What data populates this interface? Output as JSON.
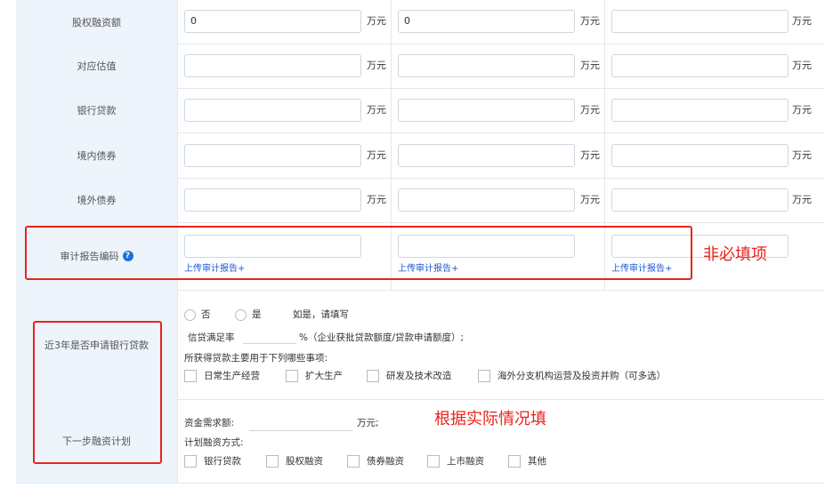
{
  "units": "万元",
  "rows": {
    "equity_financing": {
      "label": "股权融资额",
      "values": [
        "0",
        "0",
        ""
      ]
    },
    "valuation": {
      "label": "对应估值",
      "values": [
        "",
        "",
        ""
      ]
    },
    "bank_loan": {
      "label": "银行贷款",
      "values": [
        "",
        "",
        ""
      ]
    },
    "domestic_bond": {
      "label": "境内债券",
      "values": [
        "",
        "",
        ""
      ]
    },
    "foreign_bond": {
      "label": "境外债券",
      "values": [
        "",
        "",
        ""
      ]
    }
  },
  "audit": {
    "label": "审计报告编码",
    "help_icon": "?",
    "upload_label": "上传审计报告+"
  },
  "bank_apply": {
    "label": "近3年是否申请银行贷款",
    "no": "否",
    "yes": "是",
    "if_yes": "如是，请填写",
    "rate_label": "信贷满足率",
    "rate_note": "%（企业获批贷款额度/贷款申请额度）;",
    "usage_label": "所获得贷款主要用于下列哪些事项:",
    "usage_options": [
      "日常生产经营",
      "扩大生产",
      "研发及技术改造",
      "海外分支机构运营及投资并购（可多选）"
    ]
  },
  "next_plan": {
    "label": "下一步融资计划",
    "demand_label": "资金需求额:",
    "demand_unit": "万元;",
    "method_label": "计划融资方式:",
    "methods": [
      "银行贷款",
      "股权融资",
      "债券融资",
      "上市融资",
      "其他"
    ]
  },
  "annotations": {
    "optional": "非必填项",
    "fill_actual": "根据实际情况填"
  },
  "colors": {
    "accent": "#e8241b",
    "link": "#1a56d6",
    "label_bg": "#eef4fb"
  }
}
